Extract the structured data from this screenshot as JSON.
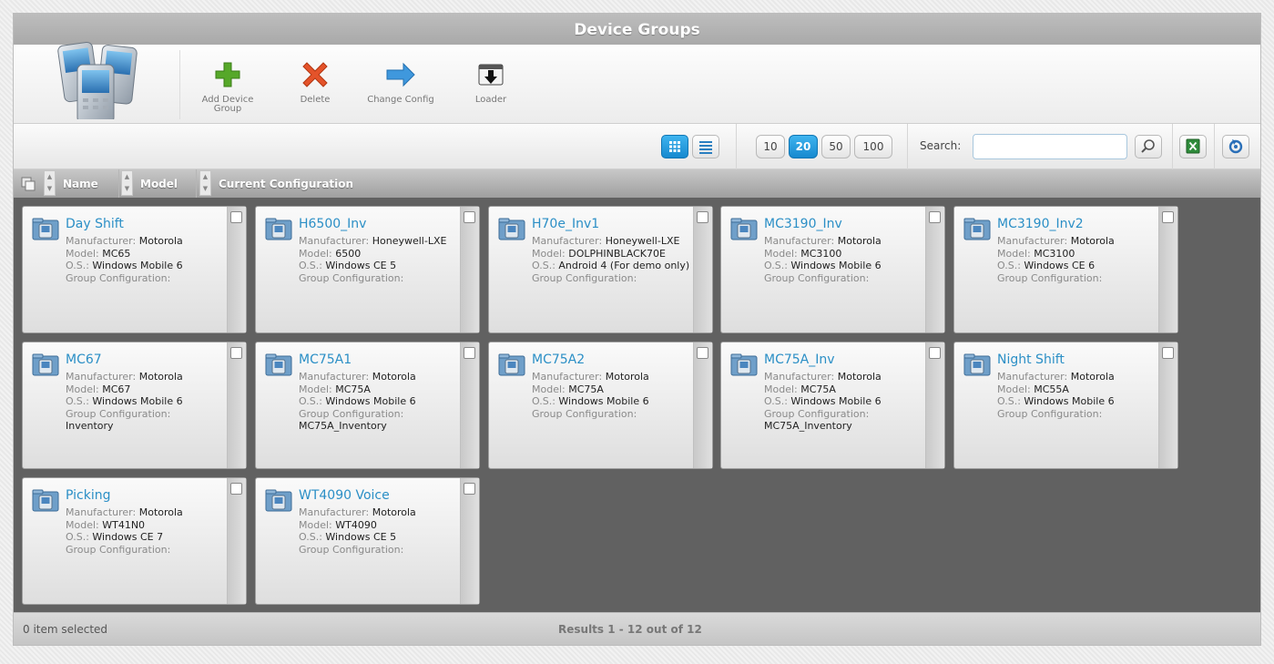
{
  "window": {
    "title": "Device Groups"
  },
  "ribbon": {
    "buttons": [
      {
        "label": "Add Device Group",
        "icon": "plus-icon",
        "color": "#4a9c1f"
      },
      {
        "label": "Delete",
        "icon": "delete-x-icon",
        "color": "#d9461c"
      },
      {
        "label": "Change Config",
        "icon": "arrow-right-icon",
        "color": "#2a86d2"
      },
      {
        "label": "Loader",
        "icon": "loader-folder-icon"
      }
    ]
  },
  "toolbar": {
    "views": [
      {
        "name": "grid-view",
        "icon": "grid-icon",
        "active": true
      },
      {
        "name": "list-view",
        "icon": "list-icon",
        "active": false
      }
    ],
    "page_sizes": [
      "10",
      "20",
      "50",
      "100"
    ],
    "page_size_selected": "20",
    "search_label": "Search:",
    "search_value": "",
    "accent": "#1789cf"
  },
  "columns": [
    "Name",
    "Model",
    "Current Configuration"
  ],
  "cards": [
    {
      "name": "Day Shift",
      "manufacturer": "Motorola",
      "model": "MC65",
      "os": "Windows Mobile 6",
      "group_config": ""
    },
    {
      "name": "H6500_Inv",
      "manufacturer": "Honeywell-LXE",
      "model": "6500",
      "os": "Windows CE 5",
      "group_config": ""
    },
    {
      "name": "H70e_Inv1",
      "manufacturer": "Honeywell-LXE",
      "model": "DOLPHINBLACK70E",
      "os": "Android 4 (For demo only)",
      "group_config": ""
    },
    {
      "name": "MC3190_Inv",
      "manufacturer": "Motorola",
      "model": "MC3100",
      "os": "Windows Mobile 6",
      "group_config": ""
    },
    {
      "name": "MC3190_Inv2",
      "manufacturer": "Motorola",
      "model": "MC3100",
      "os": "Windows CE 6",
      "group_config": ""
    },
    {
      "name": "MC67",
      "manufacturer": "Motorola",
      "model": "MC67",
      "os": "Windows Mobile 6",
      "group_config": "Inventory"
    },
    {
      "name": "MC75A1",
      "manufacturer": "Motorola",
      "model": "MC75A",
      "os": "Windows Mobile 6",
      "group_config": "MC75A_Inventory"
    },
    {
      "name": "MC75A2",
      "manufacturer": "Motorola",
      "model": "MC75A",
      "os": "Windows Mobile 6",
      "group_config": ""
    },
    {
      "name": "MC75A_Inv",
      "manufacturer": "Motorola",
      "model": "MC75A",
      "os": "Windows Mobile 6",
      "group_config": "MC75A_Inventory"
    },
    {
      "name": "Night Shift",
      "manufacturer": "Motorola",
      "model": "MC55A",
      "os": "Windows Mobile 6",
      "group_config": ""
    },
    {
      "name": "Picking",
      "manufacturer": "Motorola",
      "model": "WT41N0",
      "os": "Windows CE 7",
      "group_config": ""
    },
    {
      "name": "WT4090 Voice",
      "manufacturer": "Motorola",
      "model": "WT4090",
      "os": "Windows CE 5",
      "group_config": ""
    }
  ],
  "card_labels": {
    "manufacturer": "Manufacturer:",
    "model": "Model:",
    "os": "O.S.:",
    "group_config": "Group Configuration:"
  },
  "status": {
    "selected": "0 item selected",
    "results": "Results 1 - 12 out of 12"
  }
}
